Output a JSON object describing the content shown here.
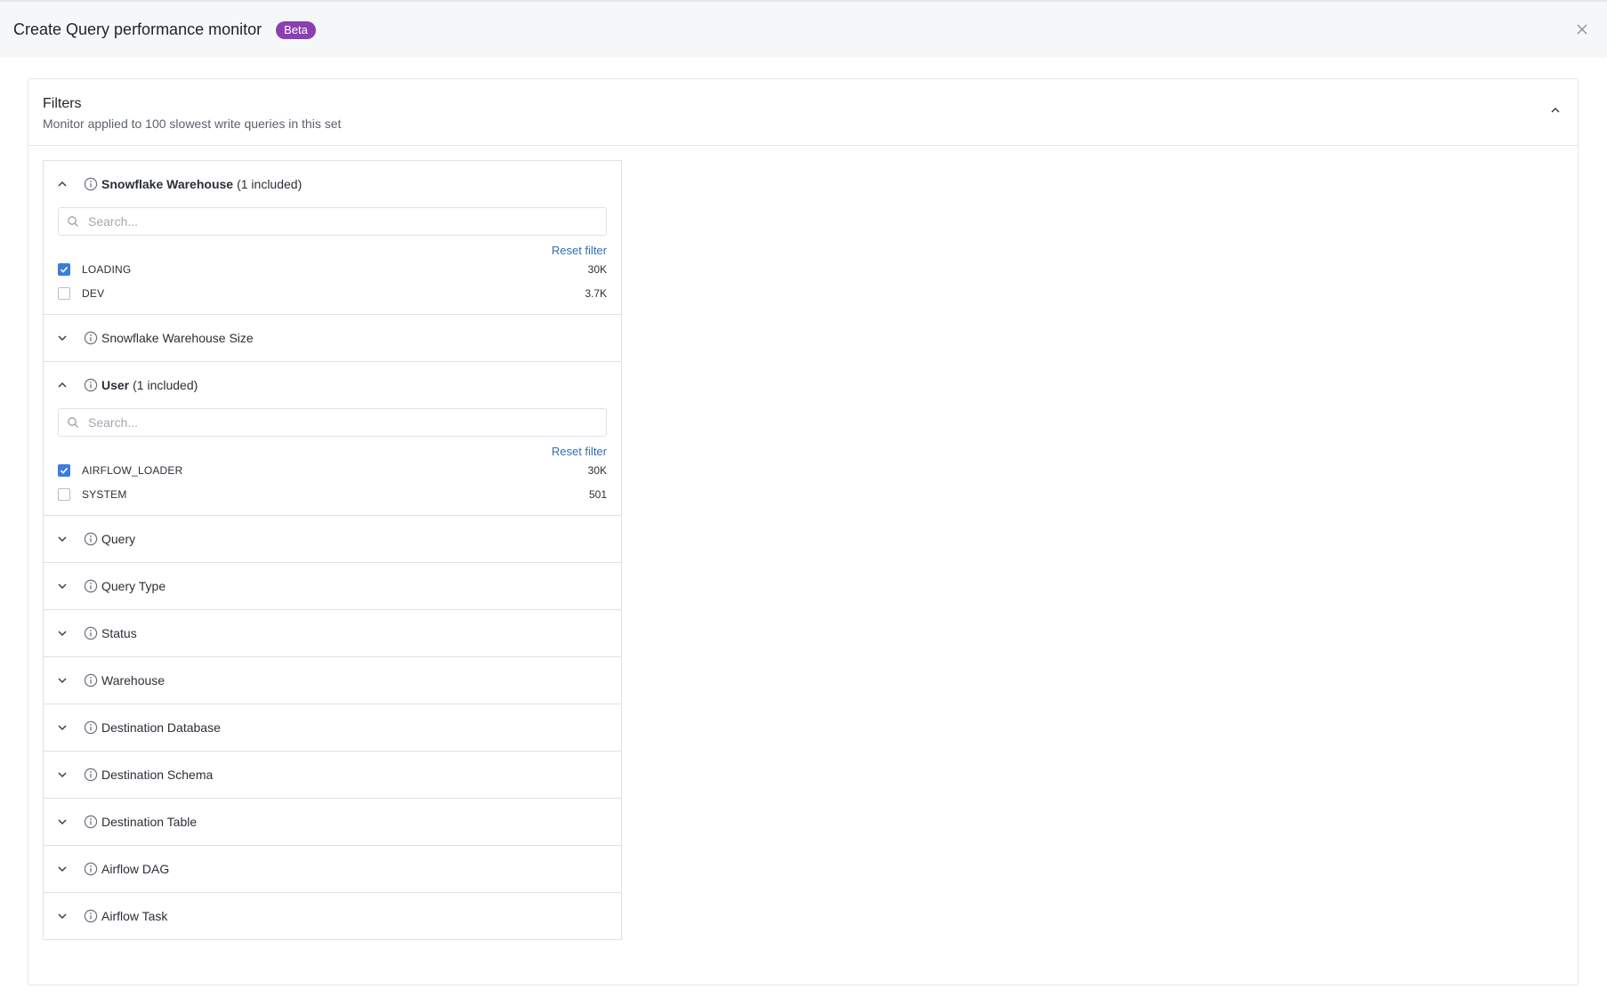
{
  "header": {
    "title": "Create Query performance monitor",
    "badge": "Beta"
  },
  "filters": {
    "title": "Filters",
    "subtitle": "Monitor applied to 100 slowest write queries in this set"
  },
  "sections": {
    "warehouse_filter": {
      "title": "Snowflake Warehouse",
      "count": "(1 included)",
      "search_placeholder": "Search...",
      "reset_label": "Reset filter",
      "options": [
        {
          "label": "LOADING",
          "count": "30K",
          "checked": true
        },
        {
          "label": "DEV",
          "count": "3.7K",
          "checked": false
        }
      ]
    },
    "warehouse_size": {
      "title": "Snowflake Warehouse Size"
    },
    "user_filter": {
      "title": "User",
      "count": "(1 included)",
      "search_placeholder": "Search...",
      "reset_label": "Reset filter",
      "options": [
        {
          "label": "AIRFLOW_LOADER",
          "count": "30K",
          "checked": true
        },
        {
          "label": "SYSTEM",
          "count": "501",
          "checked": false
        }
      ]
    },
    "collapsed": [
      {
        "title": "Query"
      },
      {
        "title": "Query Type"
      },
      {
        "title": "Status"
      },
      {
        "title": "Warehouse"
      },
      {
        "title": "Destination Database"
      },
      {
        "title": "Destination Schema"
      },
      {
        "title": "Destination Table"
      },
      {
        "title": "Airflow DAG"
      },
      {
        "title": "Airflow Task"
      }
    ]
  }
}
